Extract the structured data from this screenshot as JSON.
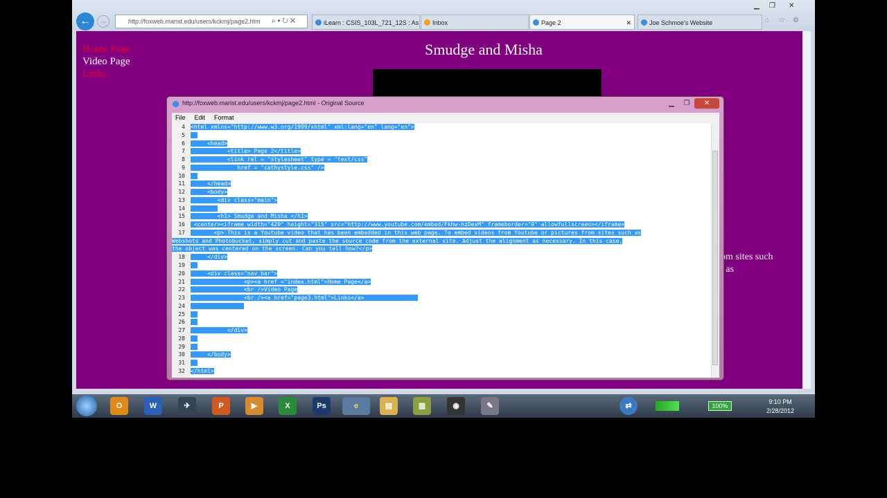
{
  "browser": {
    "address": "http://foxweb.marist.edu/users/kckmj/page2.htm",
    "tabs": [
      {
        "label": "iLearn : CSIS_103L_721_12S : As..."
      },
      {
        "label": "Inbox"
      },
      {
        "label": "Page 2"
      },
      {
        "label": "Joe Schmoe's Website"
      }
    ]
  },
  "page": {
    "nav": [
      "Home Page",
      "Video Page",
      "Links"
    ],
    "heading": "Smudge and Misha",
    "bg_text": [
      "om sites such",
      "t as"
    ]
  },
  "popup": {
    "title": "http://foxweb.marist.edu/users/kckmj/page2.html - Original Source",
    "menu": [
      "File",
      "Edit",
      "Format"
    ],
    "lines": [
      {
        "n": "4",
        "t": "<html xmlns=\"http://www.w3.org/1999/xhtml\" xml:lang=\"en\" lang=\"en\">"
      },
      {
        "n": "5",
        "t": "  "
      },
      {
        "n": "6",
        "t": "     <head>"
      },
      {
        "n": "7",
        "t": "           <title> Page 2</title>"
      },
      {
        "n": "8",
        "t": "           <link rel = \"stylesheet\" type = \"text/css\""
      },
      {
        "n": "9",
        "t": "              href = \"cathystyle.css\" />"
      },
      {
        "n": "10",
        "t": "  "
      },
      {
        "n": "11",
        "t": "     </head>"
      },
      {
        "n": "12",
        "t": "     <body>"
      },
      {
        "n": "13",
        "t": "        <div class=\"main\">"
      },
      {
        "n": "14",
        "t": "        "
      },
      {
        "n": "15",
        "t": "        <h1> Smudge and Misha </h1>"
      },
      {
        "n": "16",
        "t": " <center><iframe width=\"420\" height=\"315\" src=\"http://www.youtube.com/embed/Fkhw-hzDexM\" frameborder=\"0\" allowfullscreen></iframe>"
      },
      {
        "n": "17",
        "t": "       <p> This is a Youtube video that has been embedded in this web page. To embed videos from Youtube or pictures from sites such as"
      },
      {
        "n": "",
        "t": "Webshots and Photobucket, simply cut and paste the source code from the external site. Adjust the alignment as necessary. In this case,"
      },
      {
        "n": "",
        "t": "the object was centered on the screen. Can you tell how?</p>"
      },
      {
        "n": "18",
        "t": "     </div>"
      },
      {
        "n": "19",
        "t": "  "
      },
      {
        "n": "20",
        "t": "     <div class=\"nav_bar\">"
      },
      {
        "n": "21",
        "t": "                <p><a href =\"index.html\">Home Page</a>"
      },
      {
        "n": "22",
        "t": "                <br />Video Page"
      },
      {
        "n": "23",
        "t": "                <br /><a href=\"page3.html\">Links</a>                "
      },
      {
        "n": "24",
        "t": "                "
      },
      {
        "n": "25",
        "t": "  "
      },
      {
        "n": "26",
        "t": "  "
      },
      {
        "n": "27",
        "t": "           </div>"
      },
      {
        "n": "28",
        "t": "  "
      },
      {
        "n": "29",
        "t": "  "
      },
      {
        "n": "30",
        "t": "     </body>"
      },
      {
        "n": "31",
        "t": "  "
      },
      {
        "n": "32",
        "t": "</html>"
      }
    ]
  },
  "taskbar": {
    "battery": "100%",
    "time": "9:10 PM",
    "date": "2/28/2012",
    "apps": [
      "outlook",
      "word",
      "ps-other",
      "powerpoint",
      "media",
      "excel",
      "photoshop",
      "internet-explorer",
      "explorer",
      "notes",
      "camera",
      "tool"
    ]
  }
}
